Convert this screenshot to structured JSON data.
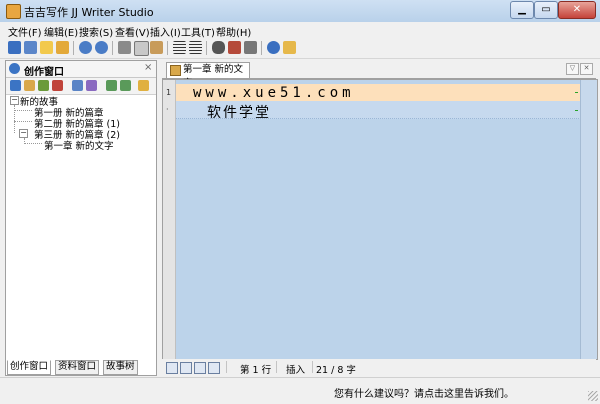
{
  "app": {
    "title": "吉吉写作 JJ Writer Studio",
    "window_buttons": [
      "minimize",
      "maximize",
      "close"
    ]
  },
  "menu": [
    "文件(F)",
    "编辑(E)",
    "搜索(S)",
    "查看(V)",
    "插入(I)",
    "工具(T)",
    "帮助(H)"
  ],
  "toolbar": {
    "icons": [
      "save-icon",
      "save-all-icon",
      "new-icon",
      "open-icon",
      "undo-icon",
      "redo-icon",
      "cut-icon",
      "copy-icon",
      "paste-icon",
      "indent-icon",
      "outdent-icon",
      "find-icon",
      "replace-icon",
      "print-icon",
      "help-icon",
      "info-icon"
    ]
  },
  "left_panel": {
    "title": "创作窗口",
    "close_glyph": "×",
    "tools": [
      "new-book-icon",
      "new-volume-icon",
      "new-chapter-icon",
      "delete-icon",
      "properties-icon",
      "import-icon",
      "move-up-icon",
      "move-down-icon",
      "home-icon"
    ],
    "tree": {
      "root": "新的故事",
      "items": [
        {
          "label": "第一册 新的篇章",
          "expander": ""
        },
        {
          "label": "第二册 新的篇章 (1)",
          "expander": ""
        },
        {
          "label": "第三册 新的篇章 (2)",
          "expander": "−"
        },
        {
          "label": "第一章 新的文字",
          "expander": ""
        }
      ]
    },
    "tabs": [
      "创作窗口",
      "资料窗口",
      "故事树"
    ]
  },
  "editor": {
    "tab_label": "第一章 新的文字",
    "line_numbers": [
      "1",
      "·"
    ],
    "lines": [
      "www.xue51.com",
      "软件学堂"
    ]
  },
  "statusbar": {
    "line": "第 1 行",
    "mode": "插入",
    "count": "21 / 8 字"
  },
  "footer": {
    "feedback": "您有什么建议吗？请点击这里告诉我们。"
  },
  "colors": {
    "editor_bg": "#bcd3ea",
    "current_line": "#fde0bb",
    "title_bar": "#b9d1ea"
  }
}
